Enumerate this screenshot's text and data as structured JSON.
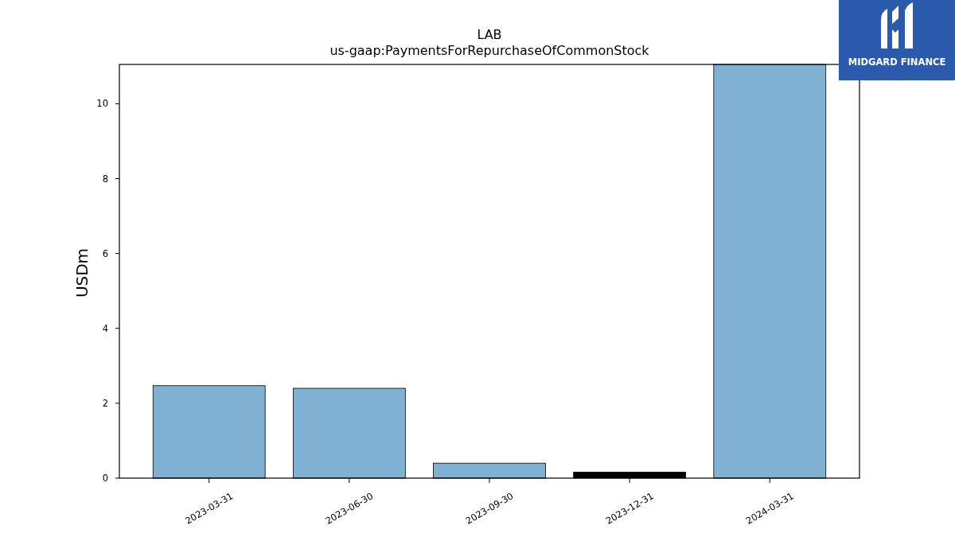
{
  "logo": {
    "text": "MIDGARD FINANCE"
  },
  "chart": {
    "chart_data": {
      "type": "bar",
      "title": "LAB\nus-gaap:PaymentsForRepurchaseOfCommonStock",
      "ylabel": "USDm",
      "categories": [
        "2023-03-31",
        "2023-06-30",
        "2023-09-30",
        "2023-12-31",
        "2024-03-31"
      ],
      "series": [
        {
          "color": "#80b1d3",
          "values": [
            2.47,
            2.4,
            0.4,
            null,
            11.05
          ]
        },
        {
          "color": "#000000",
          "values": [
            null,
            null,
            null,
            0.16,
            null
          ]
        }
      ],
      "ylim": [
        0,
        11.05
      ],
      "yticks": [
        0,
        2,
        4,
        6,
        8,
        10
      ]
    }
  }
}
